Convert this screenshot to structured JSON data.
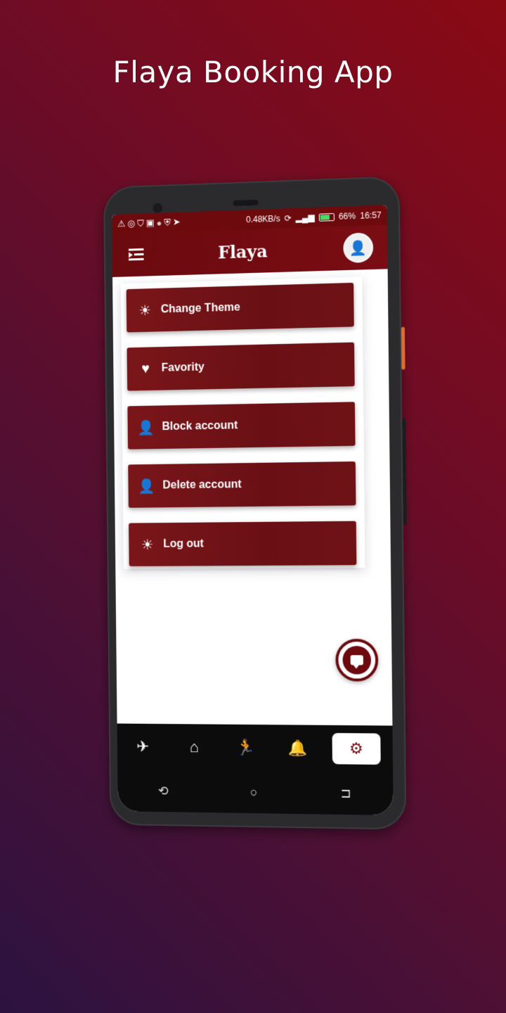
{
  "promo": {
    "title": "Flaya Booking App"
  },
  "status_bar": {
    "left_icons": [
      "warning-icon",
      "whatsapp-icon",
      "shirt-icon",
      "cast-icon",
      "record-icon",
      "shield-icon",
      "telegram-icon"
    ],
    "network_speed": "0.48KB/s",
    "battery_percent": "66%",
    "time": "16:57"
  },
  "app_bar": {
    "title": "Flaya"
  },
  "settings_menu": {
    "items": [
      {
        "label": "Change Theme",
        "icon": "brightness-icon"
      },
      {
        "label": "Favority",
        "icon": "heart-icon"
      },
      {
        "label": "Block account",
        "icon": "remove-user-icon"
      },
      {
        "label": "Delete account",
        "icon": "remove-user-icon"
      },
      {
        "label": "Log out",
        "icon": "brightness-icon"
      }
    ]
  },
  "bottom_nav": {
    "items": [
      "plane-icon",
      "home-icon",
      "walking-icon",
      "bell-icon",
      "gear-icon"
    ],
    "active": "gear-icon"
  },
  "colors": {
    "primary": "#6d0a10",
    "accent_red": "#8a0a14",
    "background_purple": "#2c1240"
  }
}
